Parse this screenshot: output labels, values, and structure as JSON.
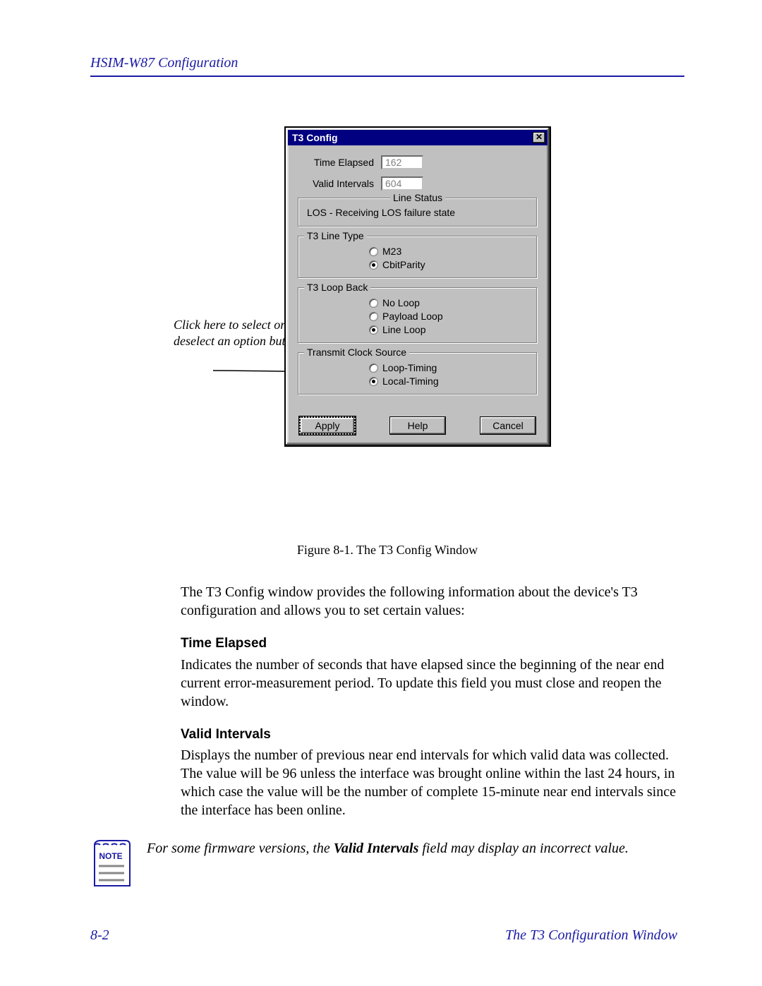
{
  "header": "HSIM-W87 Configuration",
  "callout": "Click here to select or deselect an option button.",
  "dialog": {
    "title": "T3 Config",
    "time_elapsed_label": "Time Elapsed",
    "time_elapsed_value": "162",
    "valid_intervals_label": "Valid Intervals",
    "valid_intervals_value": "604",
    "line_status_group": "Line Status",
    "line_status_text": "LOS - Receiving LOS failure state",
    "line_type_group": "T3 Line Type",
    "line_type_options": {
      "m23": "M23",
      "cbit": "CbitParity"
    },
    "loop_back_group": "T3 Loop Back",
    "loop_back_options": {
      "noloop": "No Loop",
      "payload": "Payload Loop",
      "line": "Line Loop"
    },
    "clock_group": "Transmit Clock Source",
    "clock_options": {
      "loop": "Loop-Timing",
      "local": "Local-Timing"
    },
    "buttons": {
      "apply": "Apply",
      "help": "Help",
      "cancel": "Cancel"
    }
  },
  "figure_caption": "Figure 8-1. The T3 Config Window",
  "body": {
    "intro": "The T3 Config window provides the following information about the device's T3 configuration and allows you to set certain values:",
    "time_elapsed_head": "Time Elapsed",
    "time_elapsed_body": "Indicates the number of seconds that have elapsed since the beginning of the near end current error-measurement period. To update this field you must close and reopen the window.",
    "valid_intervals_head": "Valid Intervals",
    "valid_intervals_body": "Displays the number of previous near end intervals for which valid data was collected. The value will be 96 unless the interface was brought online within the last 24 hours, in which case the value will be the number of complete 15-minute near end intervals since the interface has been online."
  },
  "note": {
    "label": "NOTE",
    "prefix": "For some firmware versions, the ",
    "bold": "Valid Intervals",
    "suffix": " field may display an incorrect value."
  },
  "footer": {
    "left": "8-2",
    "right": "The T3 Configuration Window"
  }
}
